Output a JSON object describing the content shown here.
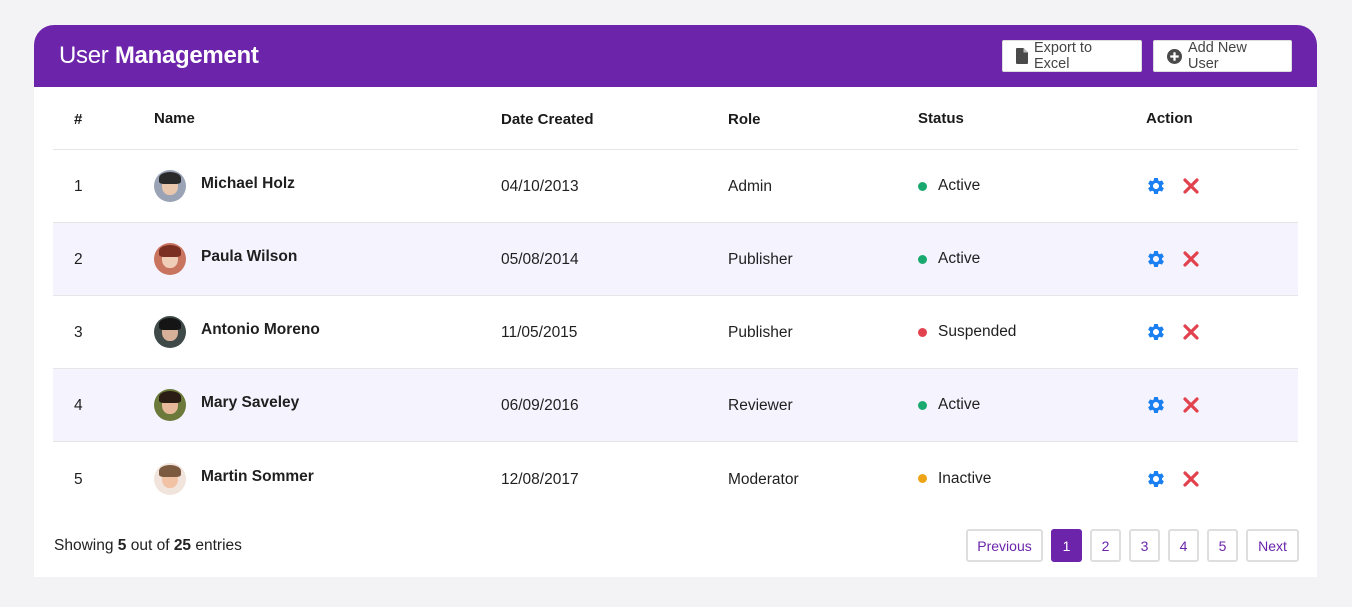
{
  "header": {
    "title_part1": "User",
    "title_part2": "Management",
    "export_label": "Export to Excel",
    "add_label": "Add New User"
  },
  "columns": [
    "#",
    "Name",
    "Date Created",
    "Role",
    "Status",
    "Action"
  ],
  "rows": [
    {
      "num": "1",
      "name": "Michael Holz",
      "date": "04/10/2013",
      "role": "Admin",
      "status": "Active",
      "status_color": "#1aaa6f",
      "avatar_bg": "#9aa3b5",
      "avatar_hair": "#2a2a2a",
      "avatar_skin": "#e9c7ad"
    },
    {
      "num": "2",
      "name": "Paula Wilson",
      "date": "05/08/2014",
      "role": "Publisher",
      "status": "Active",
      "status_color": "#1aaa6f",
      "avatar_bg": "#c9745f",
      "avatar_hair": "#7a2f22",
      "avatar_skin": "#f0cdb7"
    },
    {
      "num": "3",
      "name": "Antonio Moreno",
      "date": "11/05/2015",
      "role": "Publisher",
      "status": "Suspended",
      "status_color": "#e2424e",
      "avatar_bg": "#3f4a48",
      "avatar_hair": "#151515",
      "avatar_skin": "#d7b09a"
    },
    {
      "num": "4",
      "name": "Mary Saveley",
      "date": "06/09/2016",
      "role": "Reviewer",
      "status": "Active",
      "status_color": "#1aaa6f",
      "avatar_bg": "#6b7a3a",
      "avatar_hair": "#2b1d14",
      "avatar_skin": "#e8b89a"
    },
    {
      "num": "5",
      "name": "Martin Sommer",
      "date": "12/08/2017",
      "role": "Moderator",
      "status": "Inactive",
      "status_color": "#eda416",
      "avatar_bg": "#f1e4dc",
      "avatar_hair": "#7b5a40",
      "avatar_skin": "#f2c2a5"
    }
  ],
  "footer": {
    "showing_prefix": "Showing",
    "shown": "5",
    "middle": "out of",
    "total": "25",
    "suffix": "entries"
  },
  "pagination": {
    "prev": "Previous",
    "pages": [
      "1",
      "2",
      "3",
      "4",
      "5"
    ],
    "active_page": "1",
    "next": "Next"
  },
  "colors": {
    "accent": "#6b24aa",
    "settings_icon": "#1a7ff0",
    "delete_icon": "#e2424e"
  },
  "icons": {
    "export": "file-icon",
    "add": "plus-circle-icon",
    "settings": "gear-icon",
    "delete": "close-icon"
  }
}
